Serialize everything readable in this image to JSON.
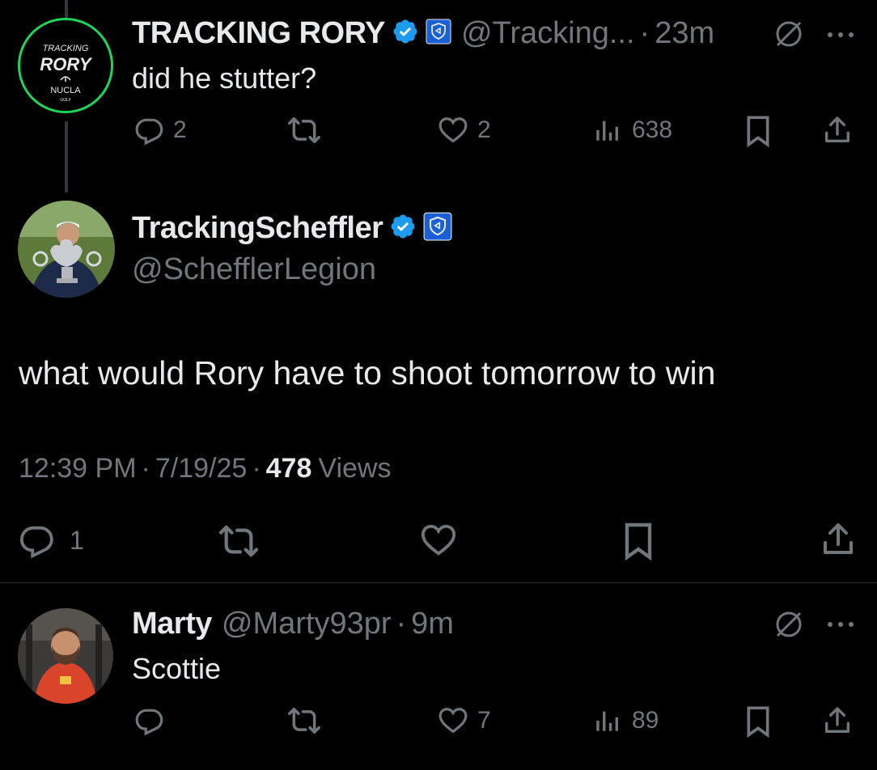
{
  "parent_tweet": {
    "avatar_text": {
      "top": "TRACKING",
      "mid": "RORY",
      "bottom": "NUCLA",
      "tiny": "GOLF"
    },
    "display_name": "TRACKING RORY",
    "handle": "@Tracking...",
    "separator": "·",
    "time": "23m",
    "text": "did he stutter?",
    "replies": "2",
    "likes": "2",
    "views": "638"
  },
  "main_tweet": {
    "display_name": "TrackingScheffler",
    "handle": "@SchefflerLegion",
    "text": "what would Rory have to shoot tomorrow to win",
    "time": "12:39 PM",
    "sep1": "·",
    "date": "7/19/25",
    "sep2": "·",
    "views_count": "478",
    "views_label": "Views",
    "replies": "1"
  },
  "reply_tweet": {
    "display_name": "Marty",
    "handle": "@Marty93pr",
    "separator": "·",
    "time": "9m",
    "text": "Scottie",
    "likes": "7",
    "views": "89"
  },
  "colors": {
    "background": "#000000",
    "text": "#e7e9ea",
    "muted": "#71767b",
    "verified_blue": "#1d9bf0",
    "affiliate_blue": "#1a5fd6",
    "rory_green": "#1fd45a"
  }
}
